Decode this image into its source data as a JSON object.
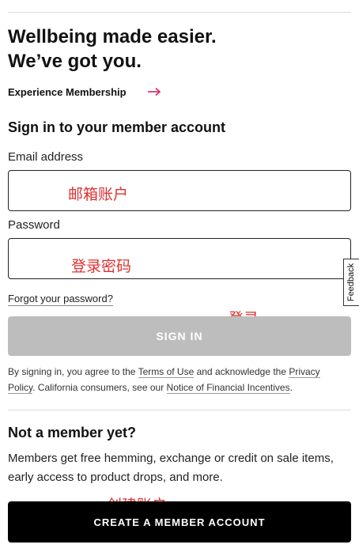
{
  "hero": {
    "title_line1": "Wellbeing made easier.",
    "title_line2": "We’ve got you.",
    "experience_link": "Experience Membership",
    "arrow_icon": "arrow-right-icon",
    "arrow_color": "#e0245e"
  },
  "signin": {
    "section_title": "Sign in to your member account",
    "email_label": "Email address",
    "email_value": "",
    "password_label": "Password",
    "password_value": "",
    "forgot_password": "Forgot your password?",
    "button_label": "SIGN IN",
    "button_color": "#bdbdbd"
  },
  "legal": {
    "part1": "By signing in, you agree to the ",
    "terms_link": "Terms of Use",
    "part2": " and acknowledge the ",
    "privacy_link": "Privacy Policy",
    "part3": ". California consumers, see our ",
    "notice_link": "Notice of Financial Incentives",
    "part4": "."
  },
  "membership": {
    "title": "Not a member yet?",
    "description": "Members get free hemming, exchange or credit on sale items, early access to product drops, and more.",
    "create_button": "CREATE A MEMBER ACCOUNT"
  },
  "feedback": {
    "label": "Feedback"
  },
  "annotations": {
    "email": "邮箱账户",
    "password": "登录密码",
    "signin": "登录",
    "create": "创建账户",
    "color": "#e03030"
  }
}
